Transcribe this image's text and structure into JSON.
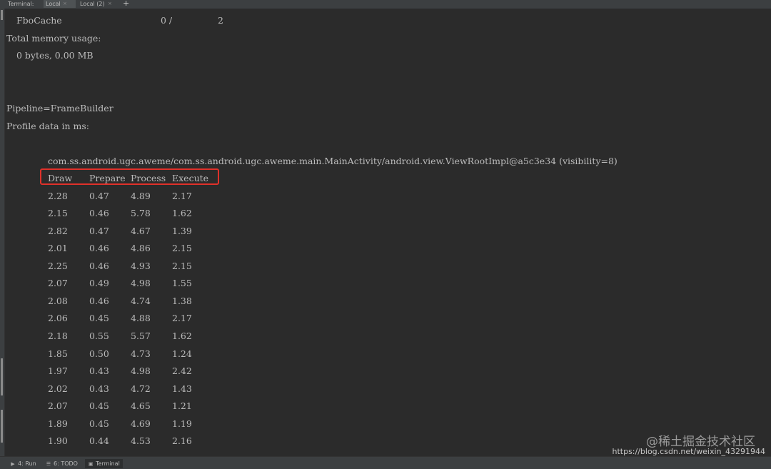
{
  "topbar": {
    "label": "Terminal:",
    "tabs": [
      {
        "label": "Local",
        "close": "×"
      },
      {
        "label": "Local (2)",
        "close": "×"
      }
    ],
    "add": "+"
  },
  "terminal": {
    "fbo_name": "FboCache",
    "fbo_used": "0 /",
    "fbo_total": "2",
    "memory_title": "Total memory usage:",
    "memory_value": "0 bytes, 0.00 MB",
    "pipeline": "Pipeline=FrameBuilder",
    "profile_title": "Profile data in ms:",
    "window": "com.ss.android.ugc.aweme/com.ss.android.ugc.aweme.main.MainActivity/android.view.ViewRootImpl@a5c3e34 (visibility=8)",
    "columns": [
      "Draw",
      "Prepare",
      "Process",
      "Execute"
    ],
    "rows": [
      [
        "2.28",
        "0.47",
        "4.89",
        "2.17"
      ],
      [
        "2.15",
        "0.46",
        "5.78",
        "1.62"
      ],
      [
        "2.82",
        "0.47",
        "4.67",
        "1.39"
      ],
      [
        "2.01",
        "0.46",
        "4.86",
        "2.15"
      ],
      [
        "2.25",
        "0.46",
        "4.93",
        "2.15"
      ],
      [
        "2.07",
        "0.49",
        "4.98",
        "1.55"
      ],
      [
        "2.08",
        "0.46",
        "4.74",
        "1.38"
      ],
      [
        "2.06",
        "0.45",
        "4.88",
        "2.17"
      ],
      [
        "2.18",
        "0.55",
        "5.57",
        "1.62"
      ],
      [
        "1.85",
        "0.50",
        "4.73",
        "1.24"
      ],
      [
        "1.97",
        "0.43",
        "4.98",
        "2.42"
      ],
      [
        "2.02",
        "0.43",
        "4.72",
        "1.43"
      ],
      [
        "2.07",
        "0.45",
        "4.65",
        "1.21"
      ],
      [
        "1.89",
        "0.45",
        "4.69",
        "1.19"
      ],
      [
        "1.90",
        "0.44",
        "4.53",
        "2.16"
      ]
    ]
  },
  "bottombar": {
    "items": [
      {
        "label": "4: Run"
      },
      {
        "label": "6: TODO"
      },
      {
        "label": "Terminal"
      }
    ]
  },
  "watermark": "@稀土掘金技术社区",
  "source_url": "https://blog.csdn.net/weixin_43291944",
  "colors": {
    "background": "#2b2b2b",
    "text": "#bbbbbb",
    "highlight_border": "#e0312a",
    "panel": "#3c3f41"
  }
}
